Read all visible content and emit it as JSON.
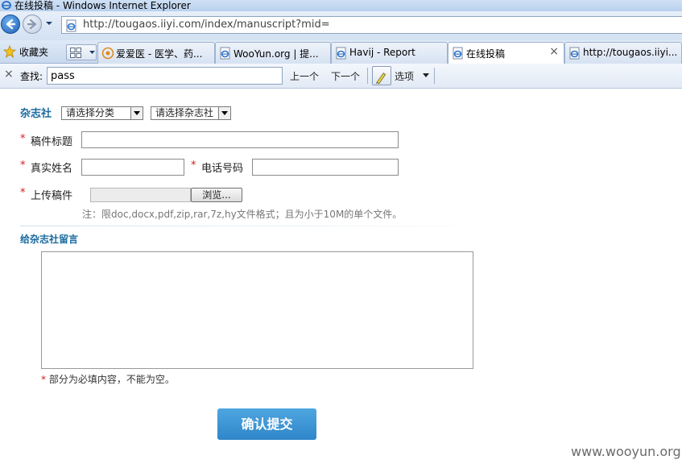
{
  "window": {
    "title": "在线投稿 - Windows Internet Explorer"
  },
  "address_bar": {
    "url": "http://tougaos.iiyi.com/index/manuscript?mid="
  },
  "favorites": {
    "label": "收藏夹"
  },
  "tabs": [
    {
      "label": "爱爱医 - 医学、药...",
      "icon": "iiyi-icon"
    },
    {
      "label": "WooYun.org | 提...",
      "icon": "ie-page-icon"
    },
    {
      "label": "Havij - Report",
      "icon": "ie-page-icon"
    },
    {
      "label": "在线投稿",
      "icon": "ie-page-icon",
      "active": true,
      "close": "×"
    },
    {
      "label": "http://tougaos.iiyi...",
      "icon": "ie-page-icon"
    }
  ],
  "find_bar": {
    "close": "×",
    "label": "查找:",
    "value": "pass",
    "prev": "上一个",
    "next": "下一个",
    "options": "选项"
  },
  "form": {
    "magazine_label": "杂志社",
    "category_select": "请选择分类",
    "magazine_select": "请选择杂志社",
    "required_mark": "*",
    "title_label": "稿件标题",
    "name_label": "真实姓名",
    "phone_label": "电话号码",
    "upload_label": "上传稿件",
    "browse_button": "浏览...",
    "upload_hint": "注：限doc,docx,pdf,zip,rar,7z,hy文件格式；且为小于10M的单个文件。",
    "message_label": "给杂志社留言",
    "required_note": "部分为必填内容，不能为空。",
    "submit_button": "确认提交"
  },
  "watermark": "www.wooyun.org",
  "colors": {
    "accent": "#1c6ba0",
    "required": "#d0201c",
    "submit": "#3a92d2"
  }
}
